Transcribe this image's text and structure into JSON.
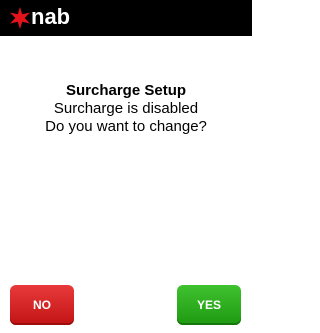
{
  "header": {
    "brand": "nab",
    "logo_icon": "nab-star-icon",
    "logo_color": "#e4131b",
    "background": "#000000"
  },
  "dialog": {
    "title": "Surcharge Setup",
    "line1": "Surcharge is disabled",
    "line2": "Do you want to change?"
  },
  "buttons": {
    "no_label": "NO",
    "yes_label": "YES",
    "no_color": "#d42020",
    "yes_color": "#2aac1c"
  }
}
